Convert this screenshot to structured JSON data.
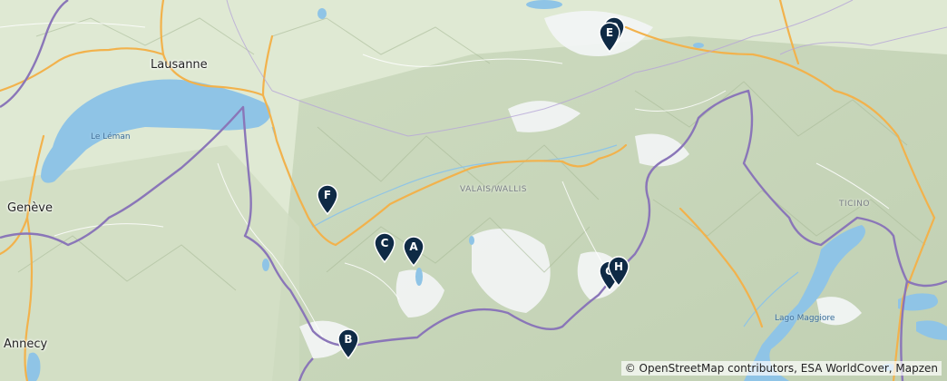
{
  "map": {
    "places": {
      "lausanne": "Lausanne",
      "geneve": "Genève",
      "annecy": "Annecy",
      "leman": "Le Léman",
      "valais": "VALAIS/WALLIS",
      "ticino": "TICINO",
      "maggiore": "Lago Maggiore"
    },
    "markers": [
      {
        "label": "A"
      },
      {
        "label": "B"
      },
      {
        "label": "C"
      },
      {
        "label": "D"
      },
      {
        "label": "E"
      },
      {
        "label": "F"
      },
      {
        "label": "G"
      },
      {
        "label": "H"
      }
    ],
    "attribution": "© OpenStreetMap contributors, ESA WorldCover, Mapzen",
    "colors": {
      "land": "#dfe9d3",
      "water": "#8fc4e6",
      "highway": "#f2b24c",
      "border": "#8a76b8",
      "marker": "#0f2a45"
    }
  }
}
